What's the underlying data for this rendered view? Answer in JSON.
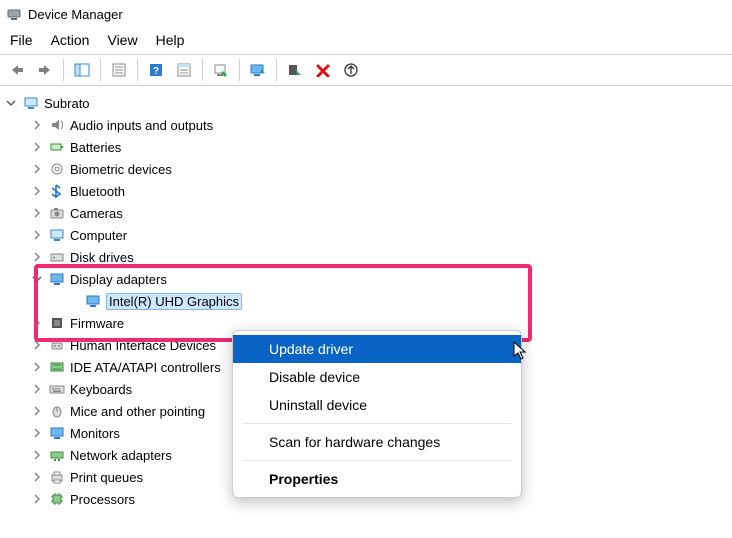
{
  "window": {
    "title": "Device Manager"
  },
  "menubar": {
    "file": "File",
    "action": "Action",
    "view": "View",
    "help": "Help"
  },
  "root": {
    "name": "Subrato"
  },
  "categories": [
    {
      "id": "audio",
      "label": "Audio inputs and outputs"
    },
    {
      "id": "batteries",
      "label": "Batteries"
    },
    {
      "id": "biometric",
      "label": "Biometric devices"
    },
    {
      "id": "bluetooth",
      "label": "Bluetooth"
    },
    {
      "id": "cameras",
      "label": "Cameras"
    },
    {
      "id": "computer",
      "label": "Computer"
    },
    {
      "id": "diskdrives",
      "label": "Disk drives"
    },
    {
      "id": "display",
      "label": "Display adapters"
    },
    {
      "id": "display-child",
      "label": "Intel(R) UHD Graphics"
    },
    {
      "id": "firmware",
      "label": "Firmware"
    },
    {
      "id": "hid",
      "label": "Human Interface Devices"
    },
    {
      "id": "ide",
      "label": "IDE ATA/ATAPI controllers"
    },
    {
      "id": "keyboards",
      "label": "Keyboards"
    },
    {
      "id": "mice",
      "label": "Mice and other pointing"
    },
    {
      "id": "monitors",
      "label": "Monitors"
    },
    {
      "id": "network",
      "label": "Network adapters"
    },
    {
      "id": "printqueues",
      "label": "Print queues"
    },
    {
      "id": "processors",
      "label": "Processors"
    }
  ],
  "context_menu": {
    "update": "Update driver",
    "disable": "Disable device",
    "uninstall": "Uninstall device",
    "scan": "Scan for hardware changes",
    "properties": "Properties"
  }
}
